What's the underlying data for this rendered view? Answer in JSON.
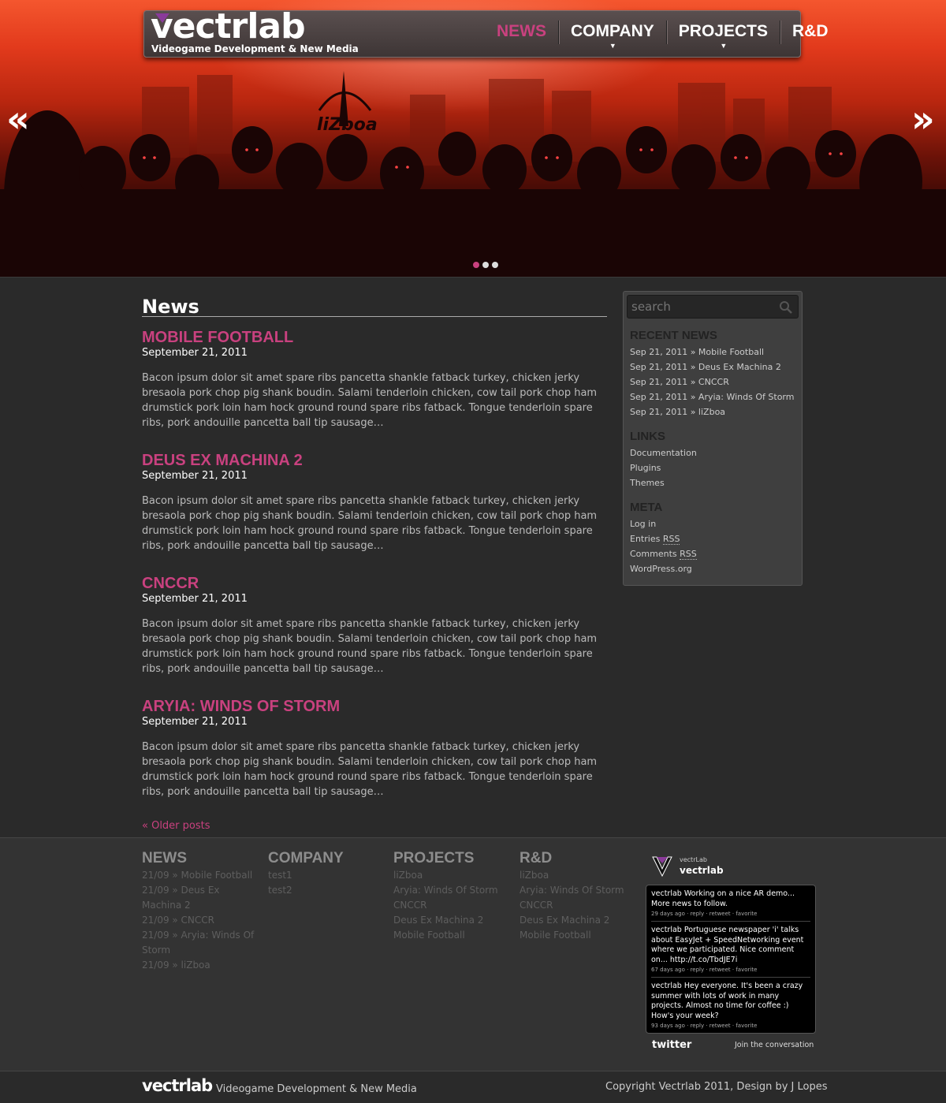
{
  "colors": {
    "accent": "#c9417f",
    "background": "#262626",
    "hero_red": "#e23a1c"
  },
  "header": {
    "logo": "vectrlab",
    "tagline": "Videogame Development & New Media",
    "nav": [
      {
        "label": "NEWS",
        "active": true,
        "has_submenu": false
      },
      {
        "label": "COMPANY",
        "active": false,
        "has_submenu": true
      },
      {
        "label": "PROJECTS",
        "active": false,
        "has_submenu": true
      },
      {
        "label": "R&D",
        "active": false,
        "has_submenu": false
      }
    ]
  },
  "hero": {
    "sign": "liZboa",
    "prev_glyph": "«",
    "next_glyph": "»",
    "slides": 3,
    "active_slide": 1
  },
  "main": {
    "section_title": "News",
    "posts": [
      {
        "title": "MOBILE FOOTBALL",
        "date": "September 21, 2011",
        "excerpt": "Bacon ipsum dolor sit amet spare ribs pancetta shankle fatback turkey, chicken jerky bresaola pork chop pig shank boudin. Salami tenderloin chicken, cow tail pork chop ham drumstick pork loin ham hock ground round spare ribs fatback. Tongue tenderloin spare ribs, pork andouille pancetta ball tip sausage…"
      },
      {
        "title": "DEUS EX MACHINA 2",
        "date": "September 21, 2011",
        "excerpt": "Bacon ipsum dolor sit amet spare ribs pancetta shankle fatback turkey, chicken jerky bresaola pork chop pig shank boudin. Salami tenderloin chicken, cow tail pork chop ham drumstick pork loin ham hock ground round spare ribs fatback. Tongue tenderloin spare ribs, pork andouille pancetta ball tip sausage…"
      },
      {
        "title": "CNCCR",
        "date": "September 21, 2011",
        "excerpt": "Bacon ipsum dolor sit amet spare ribs pancetta shankle fatback turkey, chicken jerky bresaola pork chop pig shank boudin. Salami tenderloin chicken, cow tail pork chop ham drumstick pork loin ham hock ground round spare ribs fatback. Tongue tenderloin spare ribs, pork andouille pancetta ball tip sausage…"
      },
      {
        "title": "ARYIA: WINDS OF STORM",
        "date": "September 21, 2011",
        "excerpt": "Bacon ipsum dolor sit amet spare ribs pancetta shankle fatback turkey, chicken jerky bresaola pork chop pig shank boudin. Salami tenderloin chicken, cow tail pork chop ham drumstick pork loin ham hock ground round spare ribs fatback. Tongue tenderloin spare ribs, pork andouille pancetta ball tip sausage…"
      }
    ],
    "older_posts": "« Older posts"
  },
  "sidebar": {
    "search_placeholder": "search",
    "recent_title": "RECENT NEWS",
    "recent": [
      "Sep 21, 2011 » Mobile Football",
      "Sep 21, 2011 » Deus Ex Machina 2",
      "Sep 21, 2011 » CNCCR",
      "Sep 21, 2011 » Aryia: Winds Of Storm",
      "Sep 21, 2011 » liZboa"
    ],
    "links_title": "LINKS",
    "links": [
      "Documentation",
      "Plugins",
      "Themes"
    ],
    "meta_title": "META",
    "meta": {
      "login": "Log in",
      "entries_prefix": "Entries",
      "comments_prefix": "Comments",
      "rss": "RSS",
      "wordpress": "WordPress.org"
    }
  },
  "footer": {
    "columns": [
      {
        "title": "NEWS",
        "items": [
          "21/09 » Mobile Football",
          "21/09 » Deus Ex",
          "Machina 2",
          "21/09 » CNCCR",
          "21/09 » Aryia: Winds Of",
          "Storm",
          "21/09 » liZboa"
        ]
      },
      {
        "title": "COMPANY",
        "items": [
          "test1",
          "test2"
        ]
      },
      {
        "title": "PROJECTS",
        "items": [
          "liZboa",
          "Aryia: Winds Of Storm",
          "CNCCR",
          "Deus Ex Machina 2",
          "Mobile Football"
        ]
      },
      {
        "title": "R&D",
        "items": [
          "liZboa",
          "Aryia: Winds Of Storm",
          "CNCCR",
          "Deus Ex Machina 2",
          "Mobile Football"
        ]
      }
    ],
    "twitter": {
      "user_small": "vectrLab",
      "user": "vectrlab",
      "tweets": [
        {
          "text": "vectrlab Working on a nice AR demo... More news to follow.",
          "meta": "29 days ago · reply · retweet · favorite"
        },
        {
          "text": "vectrlab Portuguese newspaper 'i' talks about EasyJet + SpeedNetworking event where we participated. Nice comment on... http://t.co/TbdJE7i",
          "meta": "67 days ago · reply · retweet · favorite"
        },
        {
          "text": "vectrlab Hey everyone. It's been a crazy summer with lots of work in many projects. Almost no time for coffee :) How's your week?",
          "meta": "93 days ago · reply · retweet · favorite"
        }
      ],
      "brand": "twitter",
      "join": "Join the conversation"
    }
  },
  "bottom": {
    "logo": "vectrlab",
    "tagline": "Videogame Development & New Media",
    "copyright": "Copyright Vectrlab 2011, Design by J Lopes"
  }
}
